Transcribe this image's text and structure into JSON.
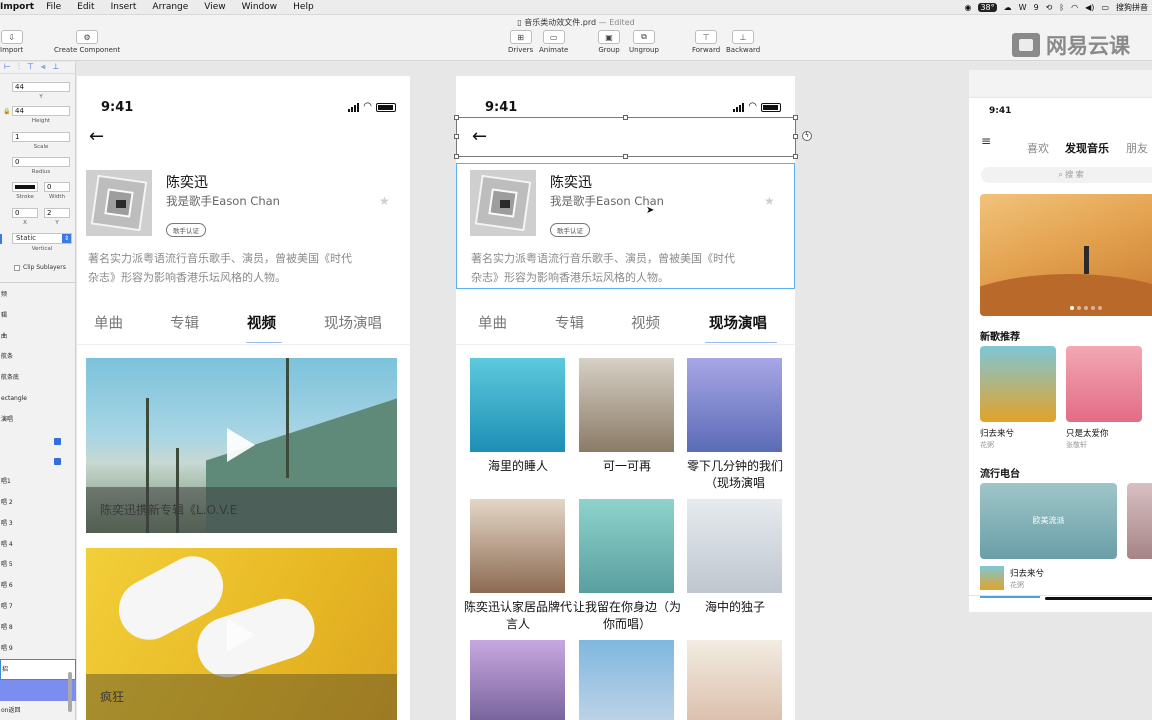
{
  "menubar": {
    "items": [
      "Import",
      "File",
      "Edit",
      "Insert",
      "Arrange",
      "View",
      "Window",
      "Help"
    ],
    "status_right": [
      "38°",
      "W",
      "9",
      "搜狗拼音"
    ]
  },
  "toolbar": {
    "doc_name": "音乐类动效文件.prd",
    "edited": "— Edited",
    "left_buttons": [
      {
        "label": "Import"
      },
      {
        "label": "Create Component"
      }
    ],
    "mid_buttons": [
      {
        "label": "Drivers",
        "icon": "drivers-icon"
      },
      {
        "label": "Animate",
        "icon": "animate-icon"
      },
      {
        "label": "Group",
        "icon": "group-icon"
      },
      {
        "label": "Ungroup",
        "icon": "ungroup-icon"
      },
      {
        "label": "Forward",
        "icon": "forward-icon"
      },
      {
        "label": "Backward",
        "icon": "backward-icon"
      }
    ]
  },
  "brand": {
    "text": "网易云课"
  },
  "inspector": {
    "y_value": "44",
    "y_label": "Y",
    "height_value": "44",
    "height_label": "Height",
    "scale_value": "1",
    "scale_label": "Scale",
    "radius_value": "0",
    "radius_label": "Radius",
    "stroke_label": "Stroke",
    "width_value": "0",
    "width_label": "Width",
    "x2_value": "0",
    "x2_label": "X",
    "y2_value": "2",
    "y2_label": "Y",
    "position_value": "Static",
    "position_label": "Vertical",
    "clip_label": "Clip Sublayers"
  },
  "layers": [
    {
      "label": "频",
      "locked": false
    },
    {
      "label": "辑",
      "locked": false
    },
    {
      "label": "曲",
      "locked": false
    },
    {
      "label": "航条",
      "locked": false
    },
    {
      "label": "航条底",
      "locked": false
    },
    {
      "label": "ectangle",
      "locked": false
    },
    {
      "label": "演唱",
      "locked": false
    },
    {
      "label": "",
      "locked": true
    },
    {
      "label": "",
      "locked": true
    },
    {
      "label": "唱1",
      "locked": false
    },
    {
      "label": "唱 2",
      "locked": false
    },
    {
      "label": "唱 3",
      "locked": false
    },
    {
      "label": "唱 4",
      "locked": false
    },
    {
      "label": "唱 5",
      "locked": false
    },
    {
      "label": "唱 6",
      "locked": false
    },
    {
      "label": "唱 7",
      "locked": false
    },
    {
      "label": "唱 8",
      "locked": false
    },
    {
      "label": "唱 9",
      "locked": false
    },
    {
      "label": "招",
      "locked": false
    },
    {
      "label": "",
      "locked": false
    },
    {
      "label": "on返回",
      "locked": false
    }
  ],
  "artboard1": {
    "time": "9:41",
    "artist_name": "陈奕迅",
    "artist_desc": "我是歌手Eason Chan",
    "badge": "歌手认证",
    "bio_line1": "著名实力派粤语流行音乐歌手、演员，曾被美国《时代",
    "bio_line2": "杂志》形容为影响香港乐坛风格的人物。",
    "tabs": [
      "单曲",
      "专辑",
      "视频",
      "现场演唱"
    ],
    "active_tab": "视频",
    "video1_caption": "陈奕迅携新专辑《L.O.V.E",
    "video2_caption": "疯狂"
  },
  "artboard2": {
    "time": "9:41",
    "artist_name": "陈奕迅",
    "artist_desc": "我是歌手Eason Chan",
    "badge": "歌手认证",
    "bio_line1": "著名实力派粤语流行音乐歌手、演员，曾被美国《时代",
    "bio_line2": "杂志》形容为影响香港乐坛风格的人物。",
    "tabs": [
      "单曲",
      "专辑",
      "视频",
      "现场演唱"
    ],
    "active_tab": "现场演唱",
    "grid": [
      {
        "title": "海里的睡人",
        "colors": [
          "#5ec9de",
          "#1d8fb4"
        ]
      },
      {
        "title": "可一可再",
        "colors": [
          "#d7d0c6",
          "#8a7b66"
        ]
      },
      {
        "title": "零下几分钟的我们（现场演唱",
        "colors": [
          "#a8a6e6",
          "#5b6bb6"
        ]
      },
      {
        "title": "陈奕迅认家居品牌代言人",
        "colors": [
          "#e4d7c7",
          "#8d6a52"
        ]
      },
      {
        "title": "让我留在你身边（为你而唱）",
        "colors": [
          "#8fd3cc",
          "#5a9fa0"
        ]
      },
      {
        "title": "海中的独子",
        "colors": [
          "#e7ebef",
          "#bfc6cf"
        ]
      },
      {
        "title": "",
        "colors": [
          "#c8a7e0",
          "#6b5a92"
        ]
      },
      {
        "title": "",
        "colors": [
          "#7fb7e0",
          "#c7d7e8"
        ]
      },
      {
        "title": "",
        "colors": [
          "#f2ece2",
          "#d9b9a5"
        ]
      }
    ]
  },
  "artboard3": {
    "time": "9:41",
    "nav": [
      "喜欢",
      "发现音乐",
      "朋友"
    ],
    "active_nav": "发现音乐",
    "search_placeholder": "搜 索",
    "section_new": "新歌推荐",
    "songs": [
      {
        "title": "归去来兮",
        "artist": "花粥",
        "colors": [
          "#7ec7d6",
          "#e3a22a"
        ]
      },
      {
        "title": "只是太爱你",
        "artist": "张敬轩",
        "colors": [
          "#f2a8b2",
          "#e46b86"
        ]
      }
    ],
    "section_radio": "流行电台",
    "radio_label": "欧美流派",
    "mini_title": "归去来兮",
    "mini_artist": "花粥"
  }
}
